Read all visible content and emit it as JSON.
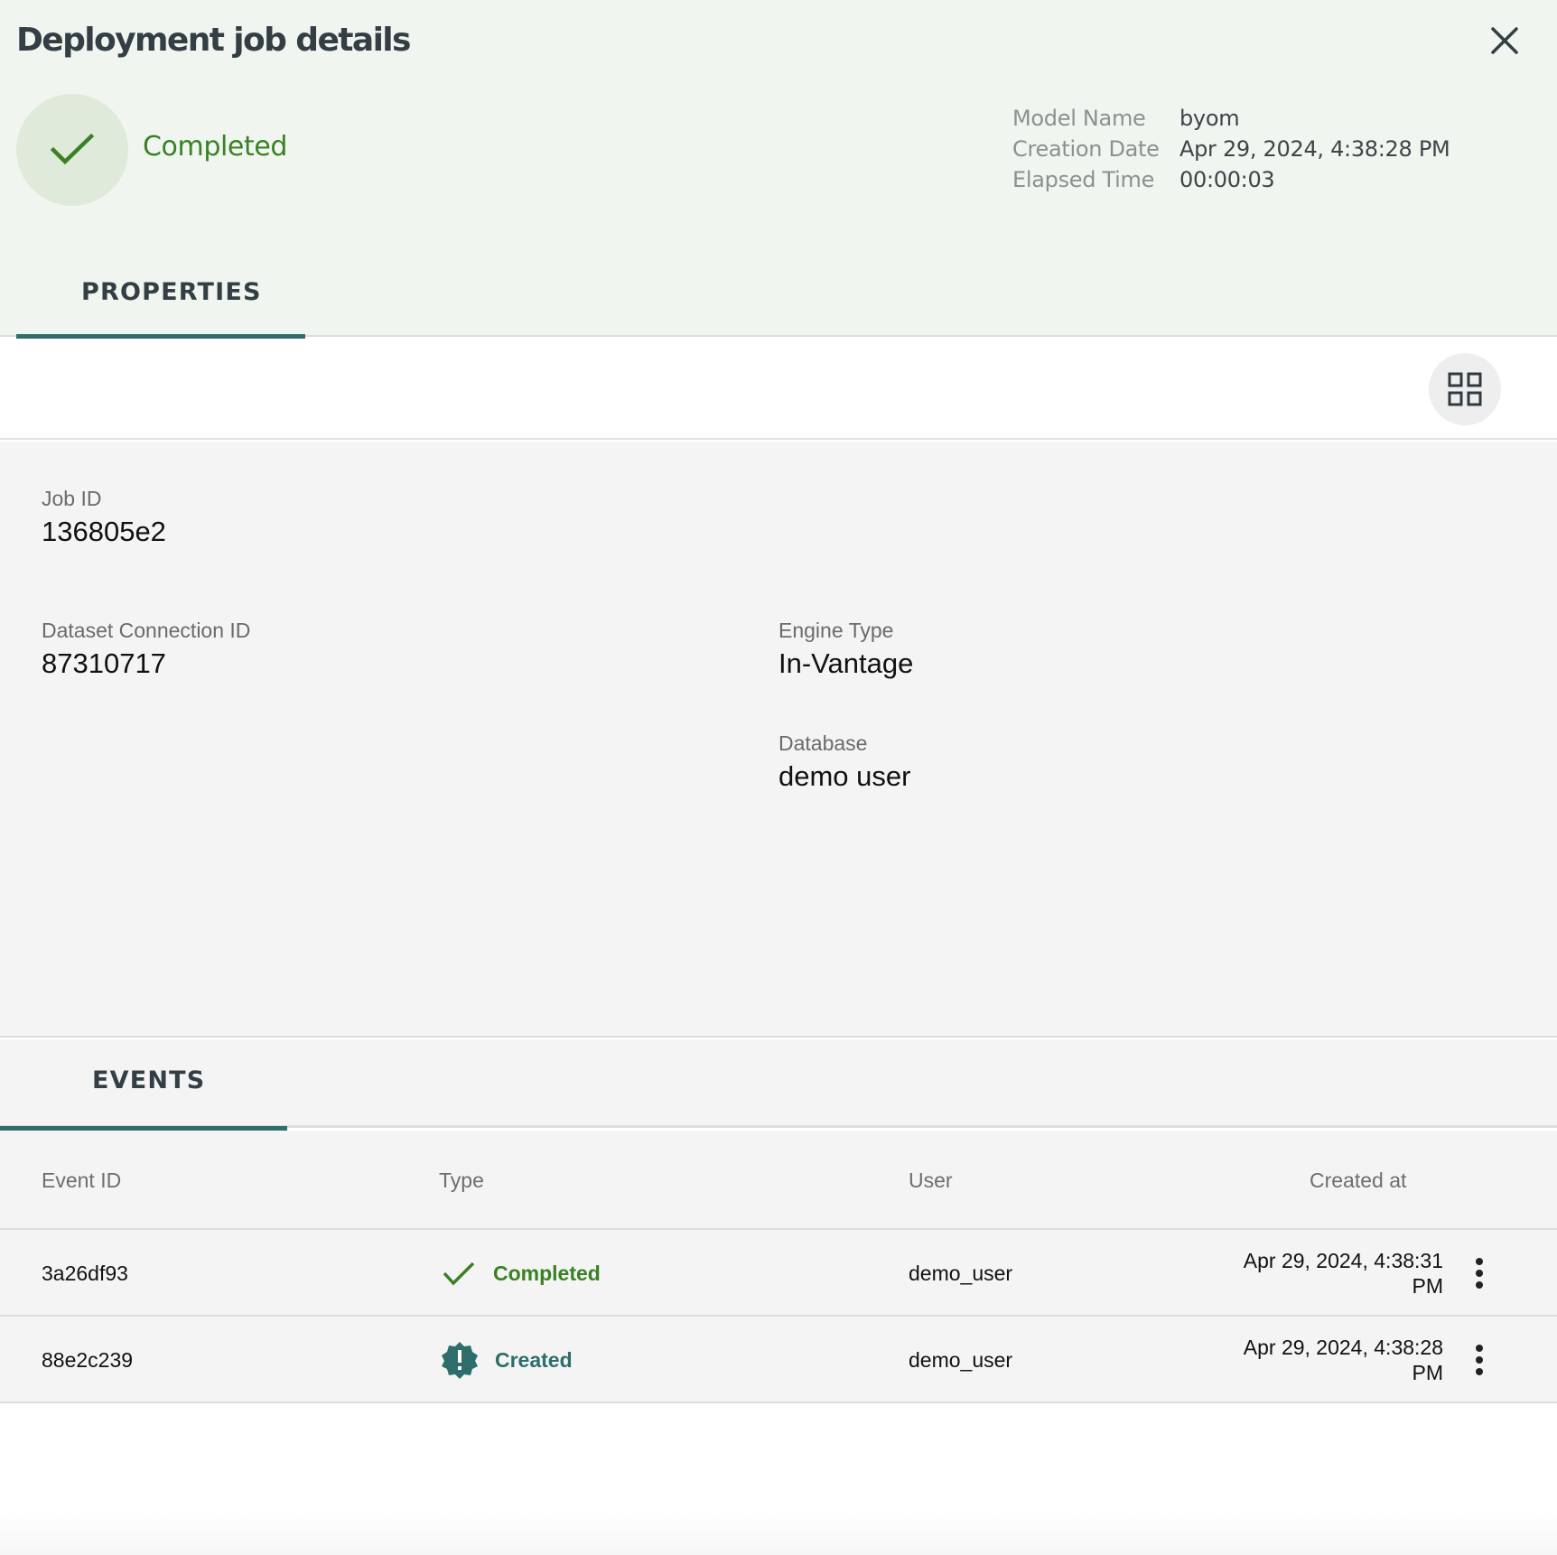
{
  "header": {
    "title": "Deployment job details",
    "status": "Completed",
    "meta": [
      {
        "label": "Model Name",
        "value": "byom"
      },
      {
        "label": "Creation Date",
        "value": "Apr 29, 2024, 4:38:28 PM"
      },
      {
        "label": "Elapsed Time",
        "value": "00:00:03"
      }
    ],
    "tab": "PROPERTIES"
  },
  "properties": {
    "job_id": {
      "label": "Job ID",
      "value": "136805e2"
    },
    "dataset_connection_id": {
      "label": "Dataset Connection ID",
      "value": "87310717"
    },
    "engine_type": {
      "label": "Engine Type",
      "value": "In-Vantage"
    },
    "database": {
      "label": "Database",
      "value": "demo user"
    }
  },
  "events": {
    "tab": "EVENTS",
    "columns": {
      "event_id": "Event ID",
      "type": "Type",
      "user": "User",
      "created_at": "Created at"
    },
    "rows": [
      {
        "event_id": "3a26df93",
        "type": "Completed",
        "type_icon": "check-icon",
        "user": "demo_user",
        "created_at_line1": "Apr 29, 2024, 4:38:31",
        "created_at_line2": "PM"
      },
      {
        "event_id": "88e2c239",
        "type": "Created",
        "type_icon": "alert-badge-icon",
        "user": "demo_user",
        "created_at_line1": "Apr 29, 2024, 4:38:28",
        "created_at_line2": "PM"
      }
    ]
  },
  "colors": {
    "header_bg": "#f1f5f0",
    "success_green": "#3a8124",
    "accent_teal": "#2e6f6d",
    "content_bg": "#f4f4f4"
  }
}
